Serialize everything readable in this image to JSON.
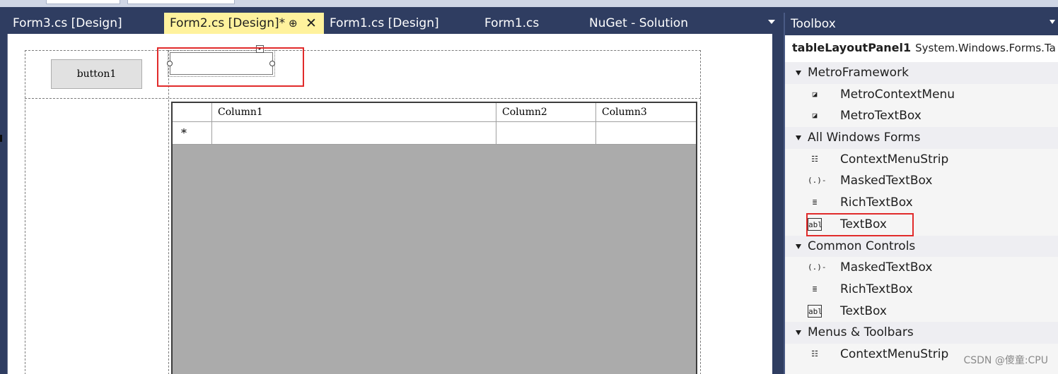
{
  "tabs": [
    {
      "label": "Form3.cs [Design]",
      "active": false
    },
    {
      "label": "Form2.cs [Design]*",
      "active": true
    },
    {
      "label": "Form1.cs [Design]",
      "active": false
    },
    {
      "label": "Form1.cs",
      "active": false
    },
    {
      "label": "NuGet - Solution",
      "active": false
    }
  ],
  "active_tab_pin": "⊕",
  "active_tab_close": "✕",
  "designer": {
    "button_label": "button1",
    "grid": {
      "columns": [
        "Column1",
        "Column2",
        "Column3"
      ],
      "new_row_marker": "*"
    }
  },
  "toolbox": {
    "title": "Toolbox",
    "selected_name": "tableLayoutPanel1",
    "selected_type": "System.Windows.Forms.Ta",
    "rows": [
      {
        "kind": "group",
        "label": "MetroFramework"
      },
      {
        "kind": "item",
        "label": "MetroContextMenu",
        "icon": "context-menu-icon"
      },
      {
        "kind": "item",
        "label": "MetroTextBox",
        "icon": "context-menu-icon"
      },
      {
        "kind": "group",
        "label": "All Windows Forms"
      },
      {
        "kind": "item",
        "label": "ContextMenuStrip",
        "icon": "menu-strip-icon"
      },
      {
        "kind": "item",
        "label": "MaskedTextBox",
        "icon": "masked-textbox-icon"
      },
      {
        "kind": "item",
        "label": "RichTextBox",
        "icon": "richtextbox-icon"
      },
      {
        "kind": "item",
        "label": "TextBox",
        "icon": "textbox-icon"
      },
      {
        "kind": "group",
        "label": "Common Controls"
      },
      {
        "kind": "item",
        "label": "MaskedTextBox",
        "icon": "masked-textbox-icon"
      },
      {
        "kind": "item",
        "label": "RichTextBox",
        "icon": "richtextbox-icon"
      },
      {
        "kind": "item",
        "label": "TextBox",
        "icon": "textbox-icon"
      },
      {
        "kind": "group",
        "label": "Menus & Toolbars"
      },
      {
        "kind": "item",
        "label": "ContextMenuStrip",
        "icon": "menu-strip-icon"
      }
    ]
  },
  "icon_glyphs": {
    "context-menu-icon": "◪",
    "menu-strip-icon": "☷",
    "masked-textbox-icon": "(.)-",
    "richtextbox-icon": "≣",
    "textbox-icon": "abl"
  },
  "watermark": "CSDN @傻童:CPU",
  "colors": {
    "chrome": "#2f3d61",
    "active_tab": "#fff29d",
    "highlight": "#e12b2b",
    "grid_bg": "#ababab"
  }
}
